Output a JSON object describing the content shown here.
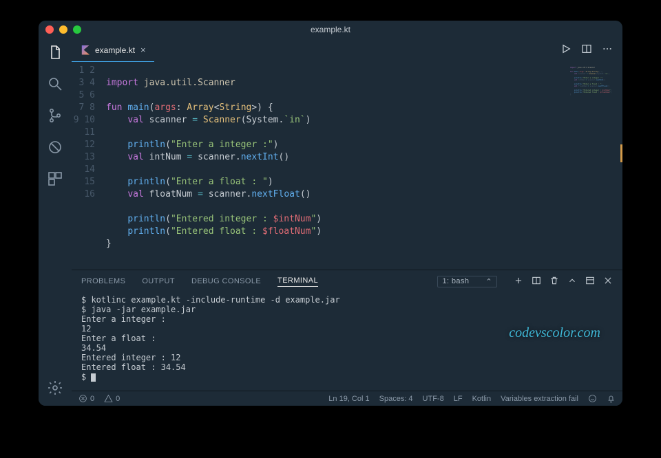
{
  "window": {
    "title": "example.kt"
  },
  "tab": {
    "label": "example.kt"
  },
  "code_lines": [
    {
      "n": 1,
      "html": ""
    },
    {
      "n": 2,
      "html": "<span class='kw'>import</span> <span class='nm'>java.util.Scanner</span>"
    },
    {
      "n": 3,
      "html": ""
    },
    {
      "n": 4,
      "html": "<span class='kw'>fun</span> <span class='fn'>main</span>(<span class='var'>args</span>: <span class='type'>Array</span>&lt;<span class='type'>String</span>&gt;) {"
    },
    {
      "n": 5,
      "html": "    <span class='kw'>val</span> scanner <span class='op'>=</span> <span class='type'>Scanner</span>(System.<span class='str'>`in`</span>)"
    },
    {
      "n": 6,
      "html": ""
    },
    {
      "n": 7,
      "html": "    <span class='fn'>println</span>(<span class='str'>\"Enter a integer :\"</span>)"
    },
    {
      "n": 8,
      "html": "    <span class='kw'>val</span> intNum <span class='op'>=</span> scanner.<span class='fn'>nextInt</span>()"
    },
    {
      "n": 9,
      "html": ""
    },
    {
      "n": 10,
      "html": "    <span class='fn'>println</span>(<span class='str'>\"Enter a float : \"</span>)"
    },
    {
      "n": 11,
      "html": "    <span class='kw'>val</span> floatNum <span class='op'>=</span> scanner.<span class='fn'>nextFloat</span>()"
    },
    {
      "n": 12,
      "html": ""
    },
    {
      "n": 13,
      "html": "    <span class='fn'>println</span>(<span class='str'>\"Entered integer : <span class='var'>$intNum</span>\"</span>)"
    },
    {
      "n": 14,
      "html": "    <span class='fn'>println</span>(<span class='str'>\"Entered float : <span class='var'>$floatNum</span>\"</span>)"
    },
    {
      "n": 15,
      "html": "}"
    },
    {
      "n": 16,
      "html": ""
    }
  ],
  "panel": {
    "tabs": [
      "PROBLEMS",
      "OUTPUT",
      "DEBUG CONSOLE",
      "TERMINAL"
    ],
    "active_tab": "TERMINAL",
    "terminal_selector": "1: bash"
  },
  "terminal_lines": [
    "$ kotlinc example.kt -include-runtime -d example.jar",
    "$ java -jar example.jar",
    "Enter a integer :",
    "12",
    "Enter a float :",
    "34.54",
    "Entered integer : 12",
    "Entered float : 34.54"
  ],
  "terminal_prompt": "$ ",
  "status": {
    "errors": "0",
    "warnings": "0",
    "pos": "Ln 19, Col 1",
    "spaces": "Spaces: 4",
    "encoding": "UTF-8",
    "eol": "LF",
    "lang": "Kotlin",
    "msg": "Variables extraction fail"
  },
  "watermark": "codevscolor.com"
}
